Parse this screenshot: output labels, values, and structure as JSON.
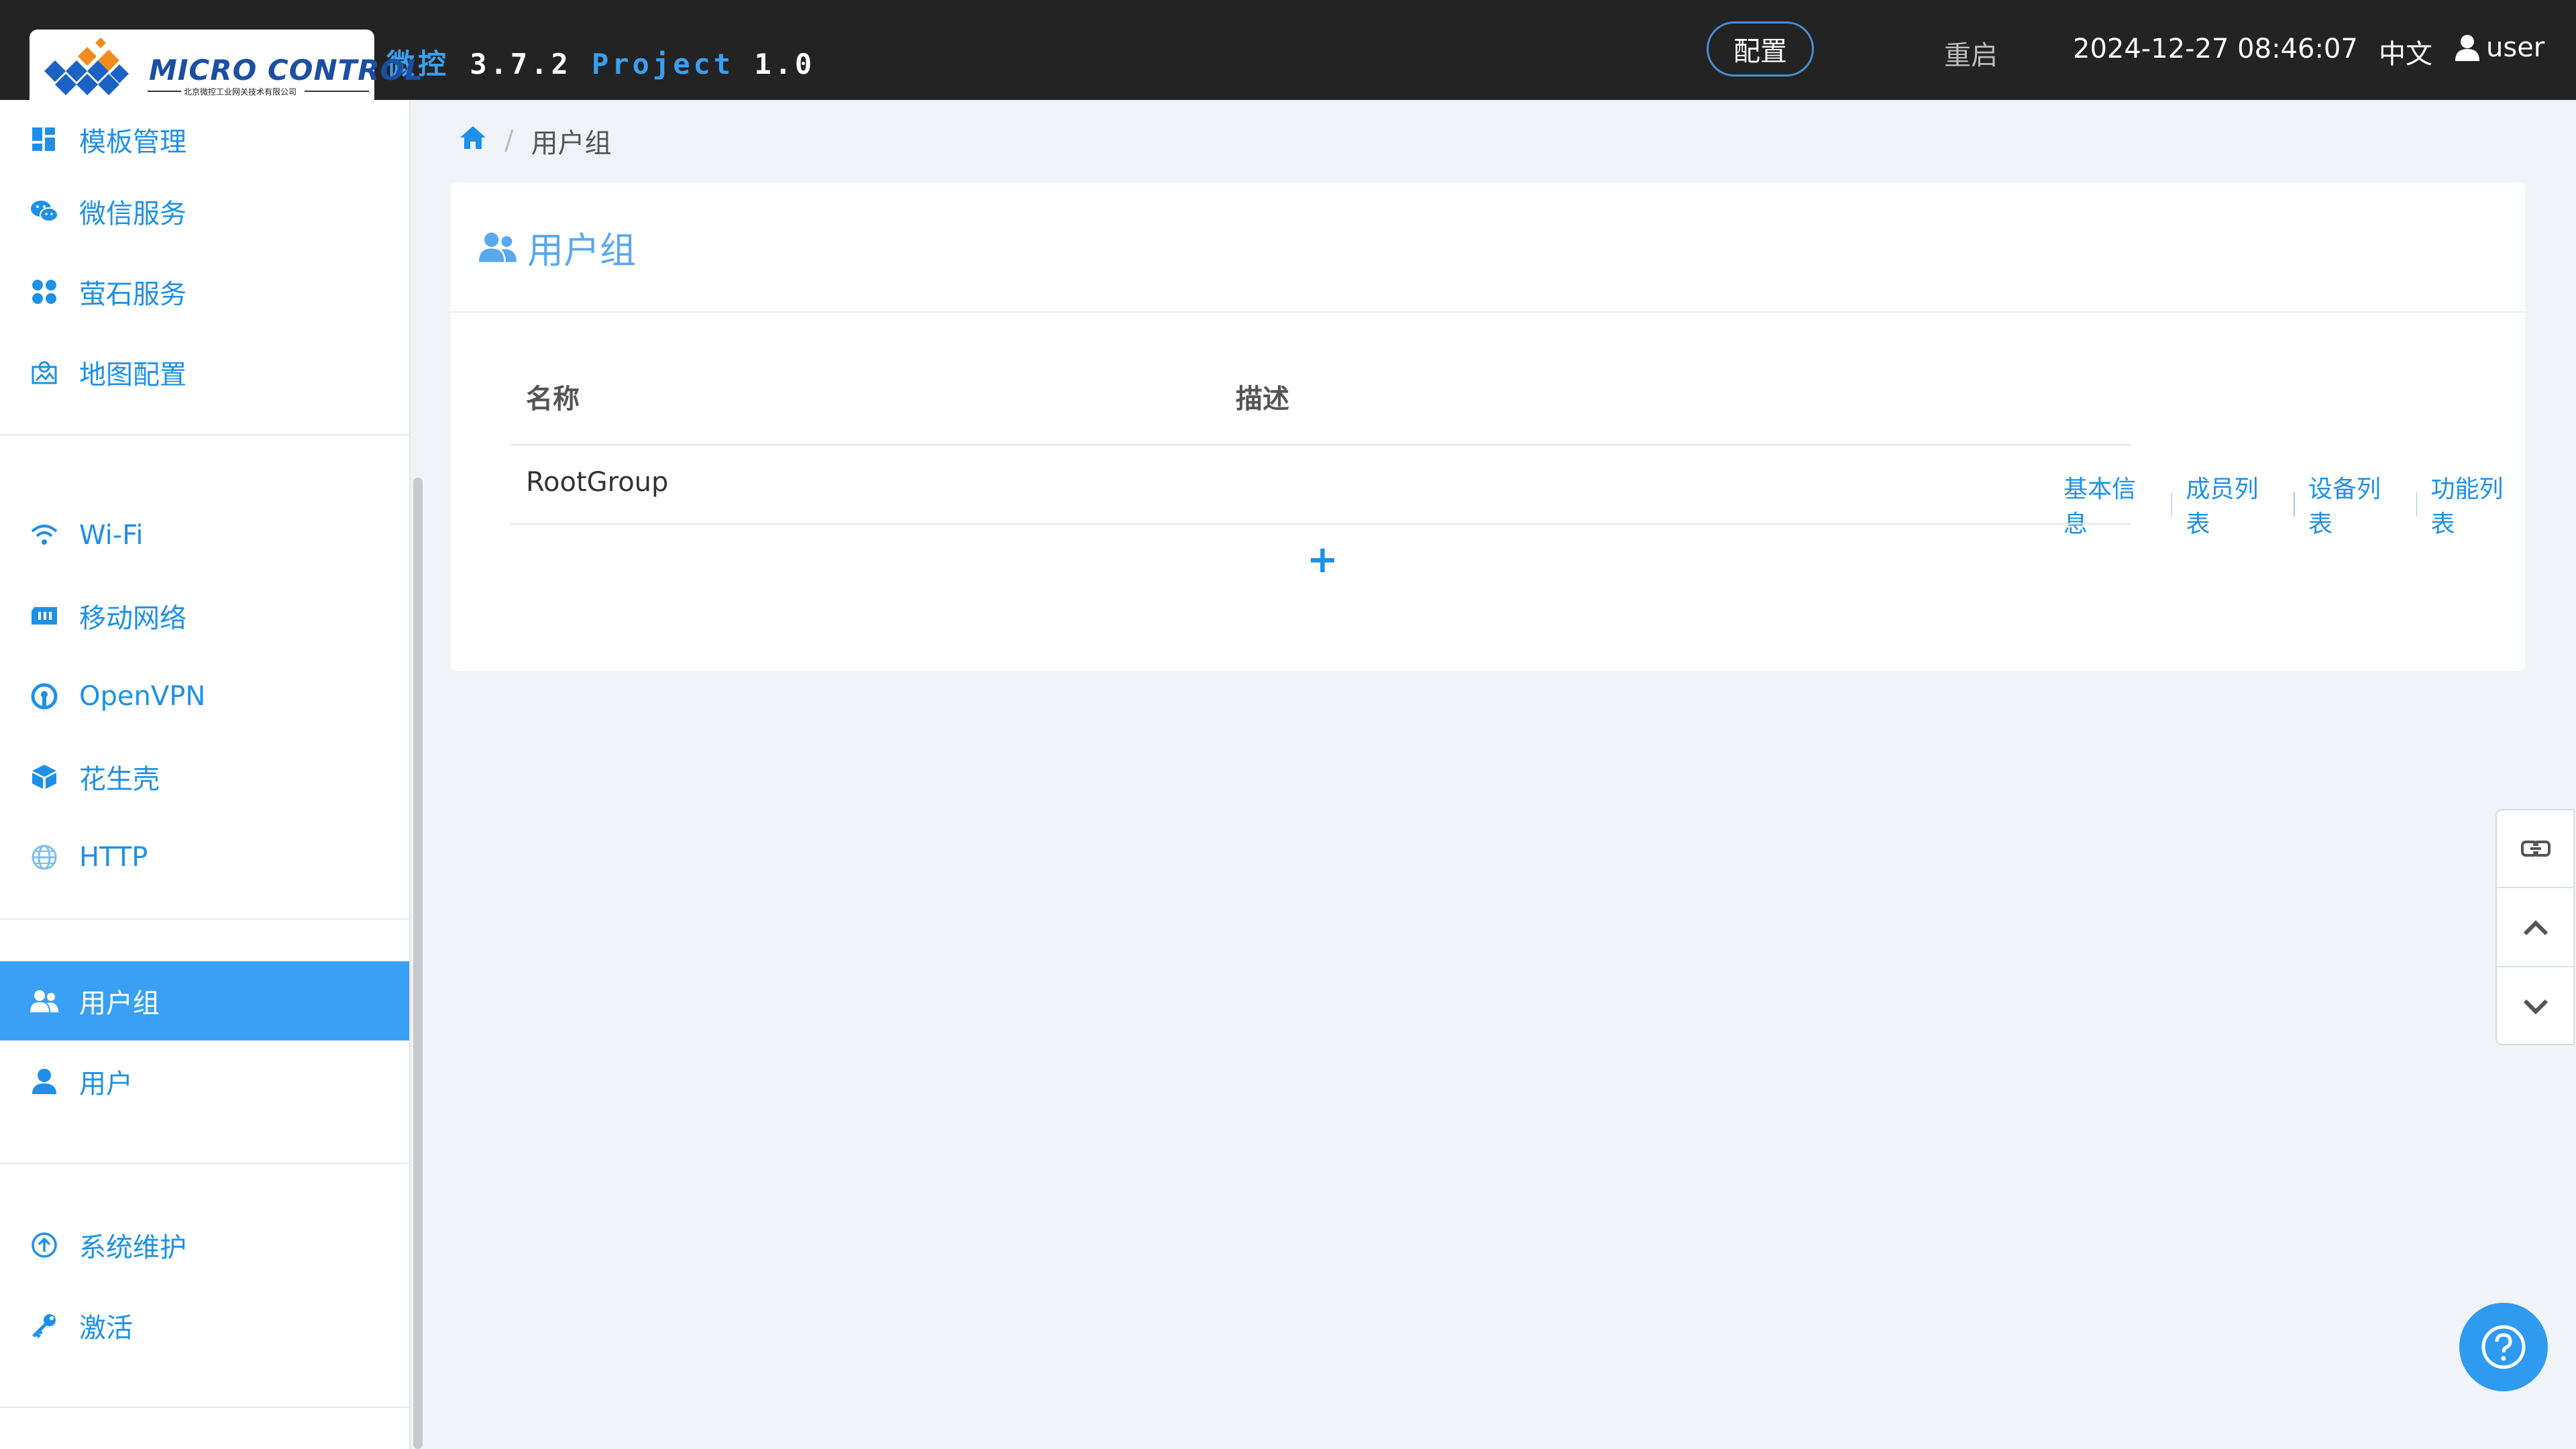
{
  "colors": {
    "accent": "#1e90e8",
    "topbar": "#232323",
    "active_nav": "#3aa0f5"
  },
  "brand": {
    "logo_text": "MICRO CONTROL",
    "logo_subtext": "北京微控工业网关技术有限公司",
    "product": "微控",
    "version": "3.7.2",
    "project_label": "Project",
    "project_version": "1.0"
  },
  "header": {
    "config_label": "配置",
    "restart_label": "重启",
    "datetime": "2024-12-27 08:46:07",
    "language": "中文",
    "username": "user"
  },
  "sidebar": {
    "groups": [
      [
        {
          "label": "模板管理",
          "icon": "dashboard-icon"
        },
        {
          "label": "微信服务",
          "icon": "wechat-icon"
        },
        {
          "label": "萤石服务",
          "icon": "fan-icon"
        },
        {
          "label": "地图配置",
          "icon": "map-icon"
        }
      ],
      [
        {
          "label": "Wi-Fi",
          "icon": "wifi-icon"
        },
        {
          "label": "移动网络",
          "icon": "sim-card-icon"
        },
        {
          "label": "OpenVPN",
          "icon": "openvpn-icon"
        },
        {
          "label": "花生壳",
          "icon": "cube-icon"
        },
        {
          "label": "HTTP",
          "icon": "globe-icon"
        }
      ],
      [
        {
          "label": "用户组",
          "icon": "users-icon",
          "active": true
        },
        {
          "label": "用户",
          "icon": "user-icon"
        }
      ],
      [
        {
          "label": "系统维护",
          "icon": "upload-circle-icon"
        },
        {
          "label": "激活",
          "icon": "key-icon"
        }
      ]
    ]
  },
  "breadcrumb": {
    "current": "用户组"
  },
  "panel": {
    "title": "用户组",
    "columns": [
      "名称",
      "描述"
    ],
    "rows": [
      {
        "name": "RootGroup",
        "description": "",
        "actions": [
          "基本信息",
          "成员列表",
          "设备列表",
          "功能列表"
        ]
      }
    ],
    "add_label": "+"
  }
}
